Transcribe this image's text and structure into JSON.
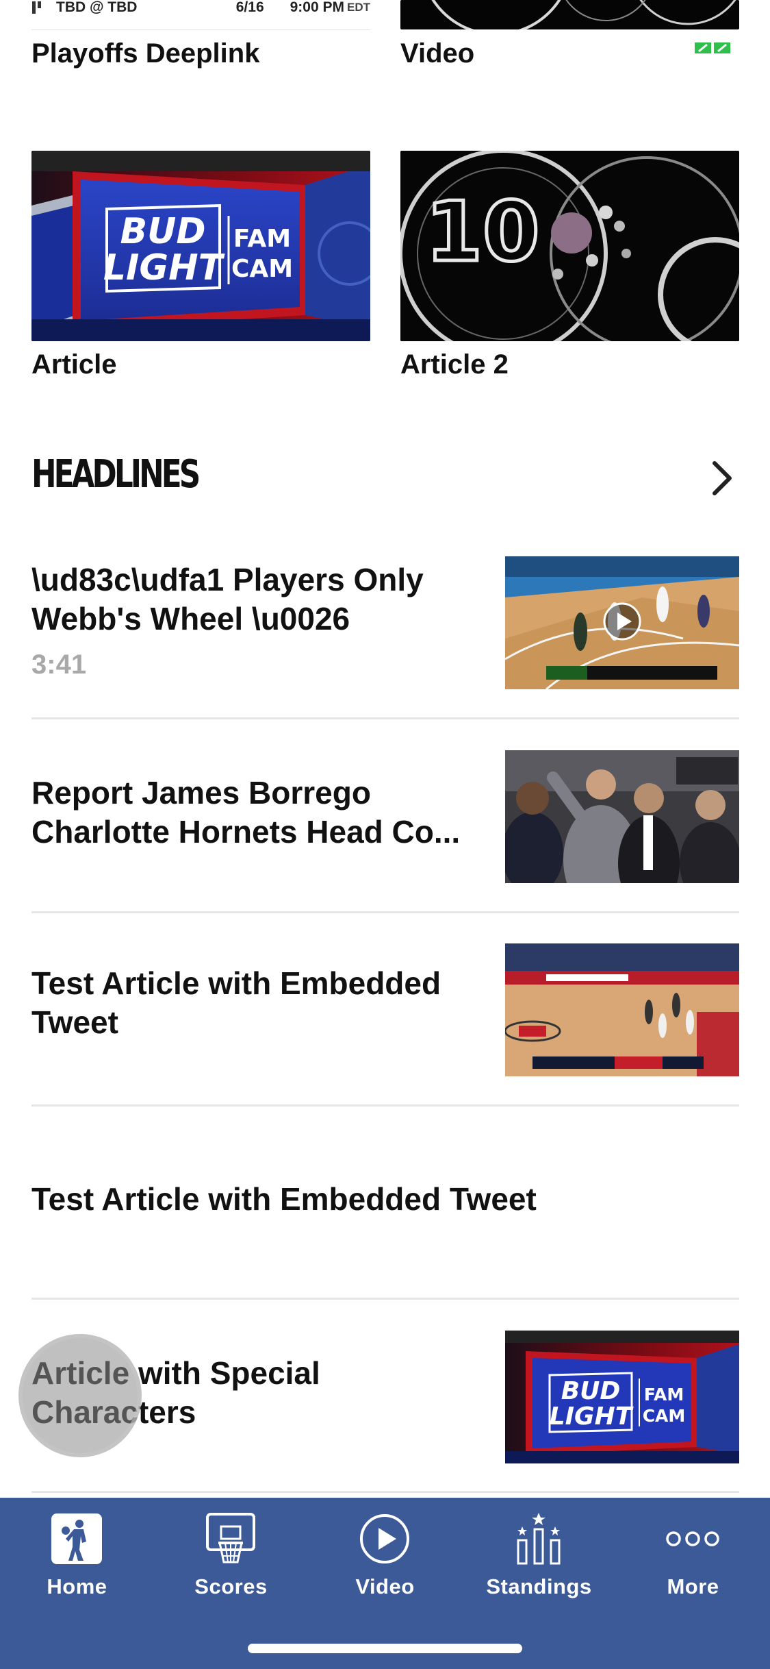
{
  "top_grid": {
    "scoreline": {
      "teams": "TBD @ TBD",
      "date": "6/16",
      "time": "9:00 PM",
      "tz": "EDT"
    },
    "cards": [
      {
        "title": "Playoffs Deeplink"
      },
      {
        "title": "Video"
      },
      {
        "title": "Article",
        "thumb_logo_top": "BUD",
        "thumb_logo_bottom": "LIGHT",
        "thumb_side_top": "FAM",
        "thumb_side_bottom": "CAM"
      },
      {
        "title": "Article 2",
        "thumb_number": "10"
      }
    ]
  },
  "headlines": {
    "title": "HEADLINES",
    "items": [
      {
        "title": "\\ud83c\\udfa1 Players Only Webb's Wheel \\u0026",
        "meta": "3:41",
        "has_video": true
      },
      {
        "title": "Report James Borrego Charlotte Hornets Head Co...",
        "meta": ""
      },
      {
        "title": "Test Article with Embedded Tweet",
        "meta": ""
      },
      {
        "title": "Test Article with Embedded Tweet",
        "meta": ""
      },
      {
        "title": "Article with Special Characters",
        "meta": "",
        "thumb_logo_top": "BUD",
        "thumb_logo_bottom": "LIGHT",
        "thumb_side_top": "FAM",
        "thumb_side_bottom": "CAM"
      }
    ]
  },
  "tabbar": {
    "tabs": [
      {
        "label": "Home",
        "icon": "nba-logo-icon",
        "active": true
      },
      {
        "label": "Scores",
        "icon": "basketball-hoop-icon"
      },
      {
        "label": "Video",
        "icon": "play-circle-icon"
      },
      {
        "label": "Standings",
        "icon": "standings-bars-icon"
      },
      {
        "label": "More",
        "icon": "more-dots-icon"
      }
    ]
  },
  "colors": {
    "tabbar_bg": "#3d5a98",
    "text": "#111111",
    "meta": "#a8a8a8",
    "divider": "#e6e6e6"
  }
}
